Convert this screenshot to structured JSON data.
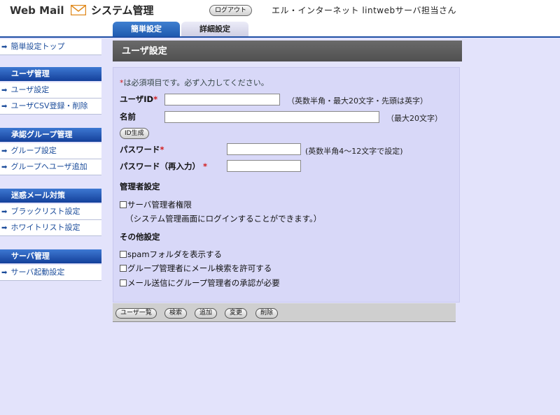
{
  "header": {
    "brand_web": "Web Mail",
    "brand_system": "システム管理",
    "logout_label": "ログアウト",
    "user_text": "エル・インターネット lintwebサーバ担当さん",
    "tabs": [
      {
        "label": "簡単設定",
        "active": true
      },
      {
        "label": "詳細設定",
        "active": false
      }
    ]
  },
  "sidebar": {
    "top_link": "簡単設定トップ",
    "sections": [
      {
        "title": "ユーザ管理",
        "items": [
          "ユーザ設定",
          "ユーザCSV登録・削除"
        ]
      },
      {
        "title": "承認グループ管理",
        "items": [
          "グループ設定",
          "グループへユーザ追加"
        ]
      },
      {
        "title": "迷惑メール対策",
        "items": [
          "ブラックリスト設定",
          "ホワイトリスト設定"
        ]
      },
      {
        "title": "サーバ管理",
        "items": [
          "サーバ起動設定"
        ]
      }
    ]
  },
  "main": {
    "title": "ユーザ設定",
    "required_mark": "*",
    "required_note": "は必須項目です。必ず入力してください。",
    "fields": {
      "user_id": {
        "label": "ユーザID",
        "value": "",
        "hint": "（英数半角・最大20文字・先頭は英字）"
      },
      "name": {
        "label": "名前",
        "value": "",
        "hint": "（最大20文字）"
      },
      "id_gen_button": "ID生成",
      "password": {
        "label": "パスワード",
        "value": "",
        "hint": "(英数半角4〜12文字で設定)"
      },
      "password_confirm": {
        "label": "パスワード（再入力）",
        "value": ""
      }
    },
    "admin_section": {
      "title": "管理者設定",
      "checkbox_label": "サーバ管理者権限",
      "checked": false,
      "note": "（システム管理画面にログインすることができます。）"
    },
    "other_section": {
      "title": "その他設定",
      "options": [
        {
          "label": "spamフォルダを表示する",
          "checked": false
        },
        {
          "label": "グループ管理者にメール検索を許可する",
          "checked": false
        },
        {
          "label": "メール送信にグループ管理者の承認が必要",
          "checked": false
        }
      ]
    },
    "actions": [
      "ユーザ一覧",
      "検索",
      "追加",
      "変更",
      "削除"
    ]
  },
  "colors": {
    "background": "#e3e3fb",
    "tab_active": "#1f5bb0",
    "section_header": "#14409a",
    "panel_title": "#5a5a5a",
    "required": "#d21b1b"
  }
}
